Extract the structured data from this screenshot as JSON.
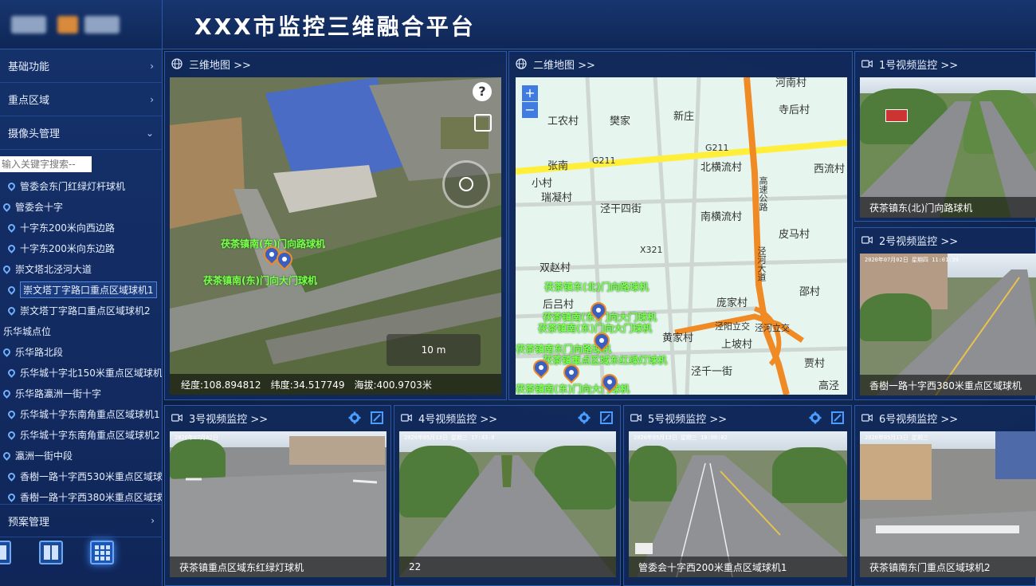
{
  "header": {
    "title": "XXX市监控三维融合平台"
  },
  "sidebar": {
    "menu": [
      {
        "label": "基础功能",
        "chevron": "›"
      },
      {
        "label": "重点区域",
        "chevron": "›"
      },
      {
        "label": "摄像头管理",
        "chevron": "⌄"
      }
    ],
    "search_placeholder": "输入关键字搜索--",
    "tree": [
      {
        "label": "管委会东门红绿灯杆球机",
        "indent": 10,
        "pin": true
      },
      {
        "label": "管委会十字",
        "indent": 4,
        "pin": true
      },
      {
        "label": "十字东200米向西边路",
        "indent": 10,
        "pin": true
      },
      {
        "label": "十字东200米向东边路",
        "indent": 10,
        "pin": true
      },
      {
        "label": "崇文塔北泾河大道",
        "indent": 4,
        "pin": true
      },
      {
        "label": "崇文塔丁字路口重点区域球机1",
        "indent": 10,
        "pin": true,
        "selected": true
      },
      {
        "label": "崇文塔丁字路口重点区域球机2",
        "indent": 10,
        "pin": true
      },
      {
        "label": "乐华城点位",
        "indent": 4,
        "pin": false
      },
      {
        "label": "乐华路北段",
        "indent": 4,
        "pin": true
      },
      {
        "label": "乐华城十字北150米重点区域球机",
        "indent": 10,
        "pin": true
      },
      {
        "label": "乐华路瀛洲一街十字",
        "indent": 4,
        "pin": true
      },
      {
        "label": "乐华城十字东南角重点区域球机1",
        "indent": 10,
        "pin": true
      },
      {
        "label": "乐华城十字东南角重点区域球机2",
        "indent": 10,
        "pin": true
      },
      {
        "label": "瀛洲一街中段",
        "indent": 4,
        "pin": true
      },
      {
        "label": "香樹一路十字西530米重点区域球",
        "indent": 10,
        "pin": true
      },
      {
        "label": "香樹一路十字西380米重点区域球",
        "indent": 10,
        "pin": true
      }
    ],
    "bottom_menu": {
      "label": "预案管理",
      "chevron": "›"
    }
  },
  "map3d": {
    "title": "三维地图 >>",
    "labels": [
      "茯茶镇南(东)门向路球机",
      "茯茶镇南(东)门向大门球机"
    ],
    "help": "?",
    "scale": "10 m",
    "longitude": "经度:108.894812",
    "latitude": "纬度:34.517749",
    "altitude": "海拔:400.9703米"
  },
  "map2d": {
    "title": "二维地图 >>",
    "zoom_in": "+",
    "zoom_out": "−",
    "places": [
      "河南村",
      "寺后村",
      "工农村",
      "樊家",
      "新庄",
      "张南",
      "G211",
      "G211",
      "小村",
      "瑞凝村",
      "北横流村",
      "西流村",
      "泾干四街",
      "南横流村",
      "皮马村",
      "X321",
      "双赵村",
      "邵村",
      "庞家村",
      "后吕村",
      "黄家村",
      "上坡村",
      "泾千一街",
      "贾村",
      "高泾",
      "泾河立交",
      "泾阳立交",
      "高速公路",
      "泾河大道"
    ],
    "camera_labels": [
      "茯茶镇东(北)门向路球机",
      "茯茶镇南(东)门向大门球机",
      "茯茶镇南(东)门向大门球机",
      "茯茶镇南东门向路球机",
      "茯茶镇重点区域东红绿灯球机",
      "茯茶镇南(东)门向大门球机"
    ]
  },
  "cameras": [
    {
      "title": "1号视频监控 >>",
      "caption": "茯茶镇东(北)门向路球机"
    },
    {
      "title": "2号视频监控 >>",
      "caption": "香樹一路十字西380米重点区域球机",
      "timestamp": "2020年07月02日 星期四 11:01:39"
    },
    {
      "title": "3号视频监控 >>",
      "caption": "茯茶镇重点区域东红绿灯球机",
      "timestamp": "2020年07月02日"
    },
    {
      "title": "4号视频监控 >>",
      "caption": "22",
      "timestamp": "2020年05月13日 星期三 17:43:0"
    },
    {
      "title": "5号视频监控 >>",
      "caption": "管委会十字西200米重点区域球机1",
      "timestamp": "2020年05月13日 星期三 18:06:02"
    },
    {
      "title": "6号视频监控 >>",
      "caption": "茯茶镇南东门重点区域球机2",
      "timestamp": "2020年05月13日 星期三"
    }
  ],
  "colors": {
    "accent": "#4a9cff",
    "header_bg": "#17356f",
    "panel_border": "#2c58a8",
    "label_green": "#7dff4d",
    "road_orange": "#f08a24",
    "road_yellow": "#ffef3a"
  }
}
